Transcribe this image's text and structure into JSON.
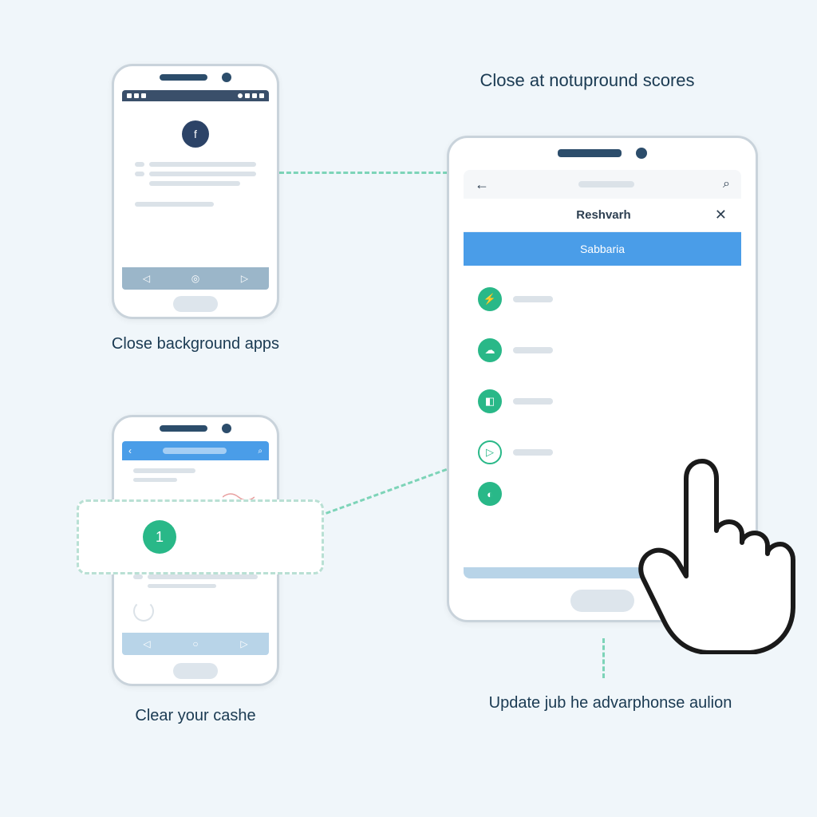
{
  "labels": {
    "top_right": "Close at notupround scores",
    "phone1": "Close background apps",
    "phone2": "Clear your cashe",
    "bottom_right": "Update jub he advarphonse aulion"
  },
  "phone1": {
    "icon_letter": "f"
  },
  "phone3": {
    "sub_title": "Reshvarh",
    "banner": "Sabbaria",
    "items": [
      {
        "icon": "⚡"
      },
      {
        "icon": "☁"
      },
      {
        "icon": "◧"
      },
      {
        "icon": "▷"
      },
      {
        "icon": "◐"
      }
    ]
  },
  "callout": {
    "number": "1"
  }
}
